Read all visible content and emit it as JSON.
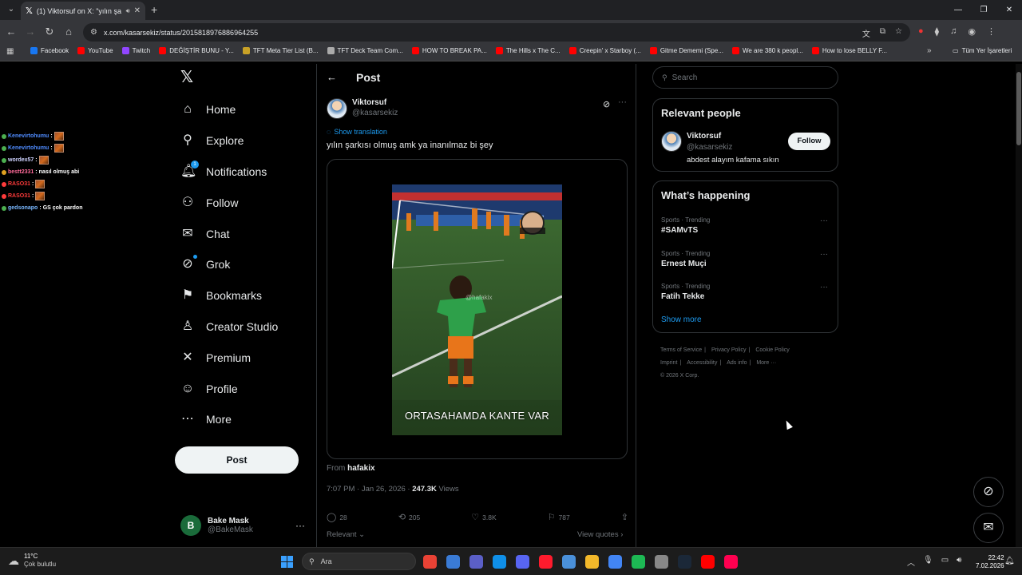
{
  "browser": {
    "tab_title": "(1) Viktorsuf on X: \"yılın şa",
    "url": "x.com/kasarsekiz/status/2015818976886964255",
    "bookmarks": [
      {
        "label": "Facebook",
        "color": "#1877f2"
      },
      {
        "label": "YouTube",
        "color": "#ff0000"
      },
      {
        "label": "Twitch",
        "color": "#9146ff"
      },
      {
        "label": "DEĞİŞTİR BUNU - Y...",
        "color": "#ff0000"
      },
      {
        "label": "TFT Meta Tier List (B...",
        "color": "#c9a227"
      },
      {
        "label": "TFT Deck Team Com...",
        "color": "#aaaaaa"
      },
      {
        "label": "HOW TO BREAK PA...",
        "color": "#ff0000"
      },
      {
        "label": "The Hills x The C...",
        "color": "#ff0000"
      },
      {
        "label": "Creepin' x Starboy (...",
        "color": "#ff0000"
      },
      {
        "label": "Gitme Dememi (Spe...",
        "color": "#ff0000"
      },
      {
        "label": "We are 380 k peopl...",
        "color": "#ff0000"
      },
      {
        "label": "How to lose BELLY F...",
        "color": "#ff0000"
      }
    ],
    "all_bookmarks_label": "Tüm Yer İşaretleri"
  },
  "chat": [
    {
      "user": "Kenevirtohumu",
      "message": "",
      "color": "#4f8cff",
      "emote": true,
      "dot_color": "#4caf50"
    },
    {
      "user": "Kenevirtohumu",
      "message": "",
      "color": "#4f8cff",
      "emote": true,
      "dot_color": "#4caf50"
    },
    {
      "user": "wordex57",
      "message": "",
      "color": "#cfd3ff",
      "emote": true,
      "dot_color": "#4caf50"
    },
    {
      "user": "bestt2331",
      "message": "nasıl olmuş abi",
      "color": "#ff6b9a",
      "emote": false,
      "dot_color": "#e0a020"
    },
    {
      "user": "RASO31",
      "message": "",
      "color": "#ff3b3b",
      "emote": true,
      "dot_color": "#ff3b3b"
    },
    {
      "user": "RASO31",
      "message": "",
      "color": "#ff3b3b",
      "emote": true,
      "dot_color": "#ff3b3b"
    },
    {
      "user": "gedsonapo",
      "message": "GS çok pardon",
      "color": "#7ab8ff",
      "emote": false,
      "dot_color": "#4caf50"
    }
  ],
  "nav": [
    {
      "label": "Home",
      "icon": "home-icon",
      "glyph": "⌂"
    },
    {
      "label": "Explore",
      "icon": "search-icon",
      "glyph": "⚲"
    },
    {
      "label": "Notifications",
      "icon": "bell-icon",
      "glyph": "🔔︎",
      "badge": "1"
    },
    {
      "label": "Follow",
      "icon": "person-add-icon",
      "glyph": "⚇"
    },
    {
      "label": "Chat",
      "icon": "mail-icon",
      "glyph": "✉"
    },
    {
      "label": "Grok",
      "icon": "grok-icon",
      "glyph": "⊘"
    },
    {
      "label": "Bookmarks",
      "icon": "bookmark-icon",
      "glyph": "⚑"
    },
    {
      "label": "Creator Studio",
      "icon": "creator-studio-icon",
      "glyph": "♙"
    },
    {
      "label": "Premium",
      "icon": "x-premium-icon",
      "glyph": "✕"
    },
    {
      "label": "Profile",
      "icon": "profile-icon",
      "glyph": "☺"
    },
    {
      "label": "More",
      "icon": "more-circle-icon",
      "glyph": "⋯"
    }
  ],
  "post_button_label": "Post",
  "account": {
    "initial": "B",
    "name": "Bake Mask",
    "handle": "@BakeMask"
  },
  "main": {
    "title": "Post",
    "author_name": "Viktorsuf",
    "author_handle": "@kasarsekiz",
    "show_translation": "Show translation",
    "text": "yılın şarkısı olmuş amk ya inanılmaz bi şey",
    "video_watermark": "@hafakix",
    "video_caption": "ORTASAHAMDA KANTE VAR",
    "from_prefix": "From",
    "from_user": "hafakix",
    "timestamp": "7:07 PM · Jan 26, 2026 · ",
    "views_count": "247.3K",
    "views_label": " Views",
    "replies": "28",
    "reposts": "205",
    "likes": "3.8K",
    "bookmarks": "787",
    "relevant_label": "Relevant",
    "view_quotes": "View quotes"
  },
  "sidebar": {
    "search_placeholder": "Search",
    "relevant_title": "Relevant people",
    "person_name": "Viktorsuf",
    "person_handle": "@kasarsekiz",
    "person_bio": "abdest alayım kafama sıkın",
    "follow_label": "Follow",
    "happening_title": "What’s happening",
    "trends": [
      {
        "category": "Sports · Trending",
        "name": "#SAMvTS"
      },
      {
        "category": "Sports · Trending",
        "name": "Ernest Muçi"
      },
      {
        "category": "Sports · Trending",
        "name": "Fatih Tekke"
      }
    ],
    "show_more": "Show more",
    "footer": [
      "Terms of Service",
      "Privacy Policy",
      "Cookie Policy",
      "Imprint",
      "Accessibility",
      "Ads info",
      "More ···",
      "© 2026 X Corp."
    ]
  },
  "taskbar": {
    "temp": "11°C",
    "weather": "Çok bulutlu",
    "search_text": "Ara",
    "time": "22:42",
    "date": "7.02.2026",
    "apps": [
      "#e94235",
      "#3a7bd5",
      "#5b5fc7",
      "#0f8fe8",
      "#5865f2",
      "#ff1b2d",
      "#4a90d9",
      "#f2b82a",
      "#4285f4",
      "#1db954",
      "#888888",
      "#1b2838",
      "#ff0000",
      "#ff0050"
    ]
  },
  "colors": {
    "accent": "#1d9bf0",
    "background": "#000000",
    "border": "#2f3336"
  }
}
